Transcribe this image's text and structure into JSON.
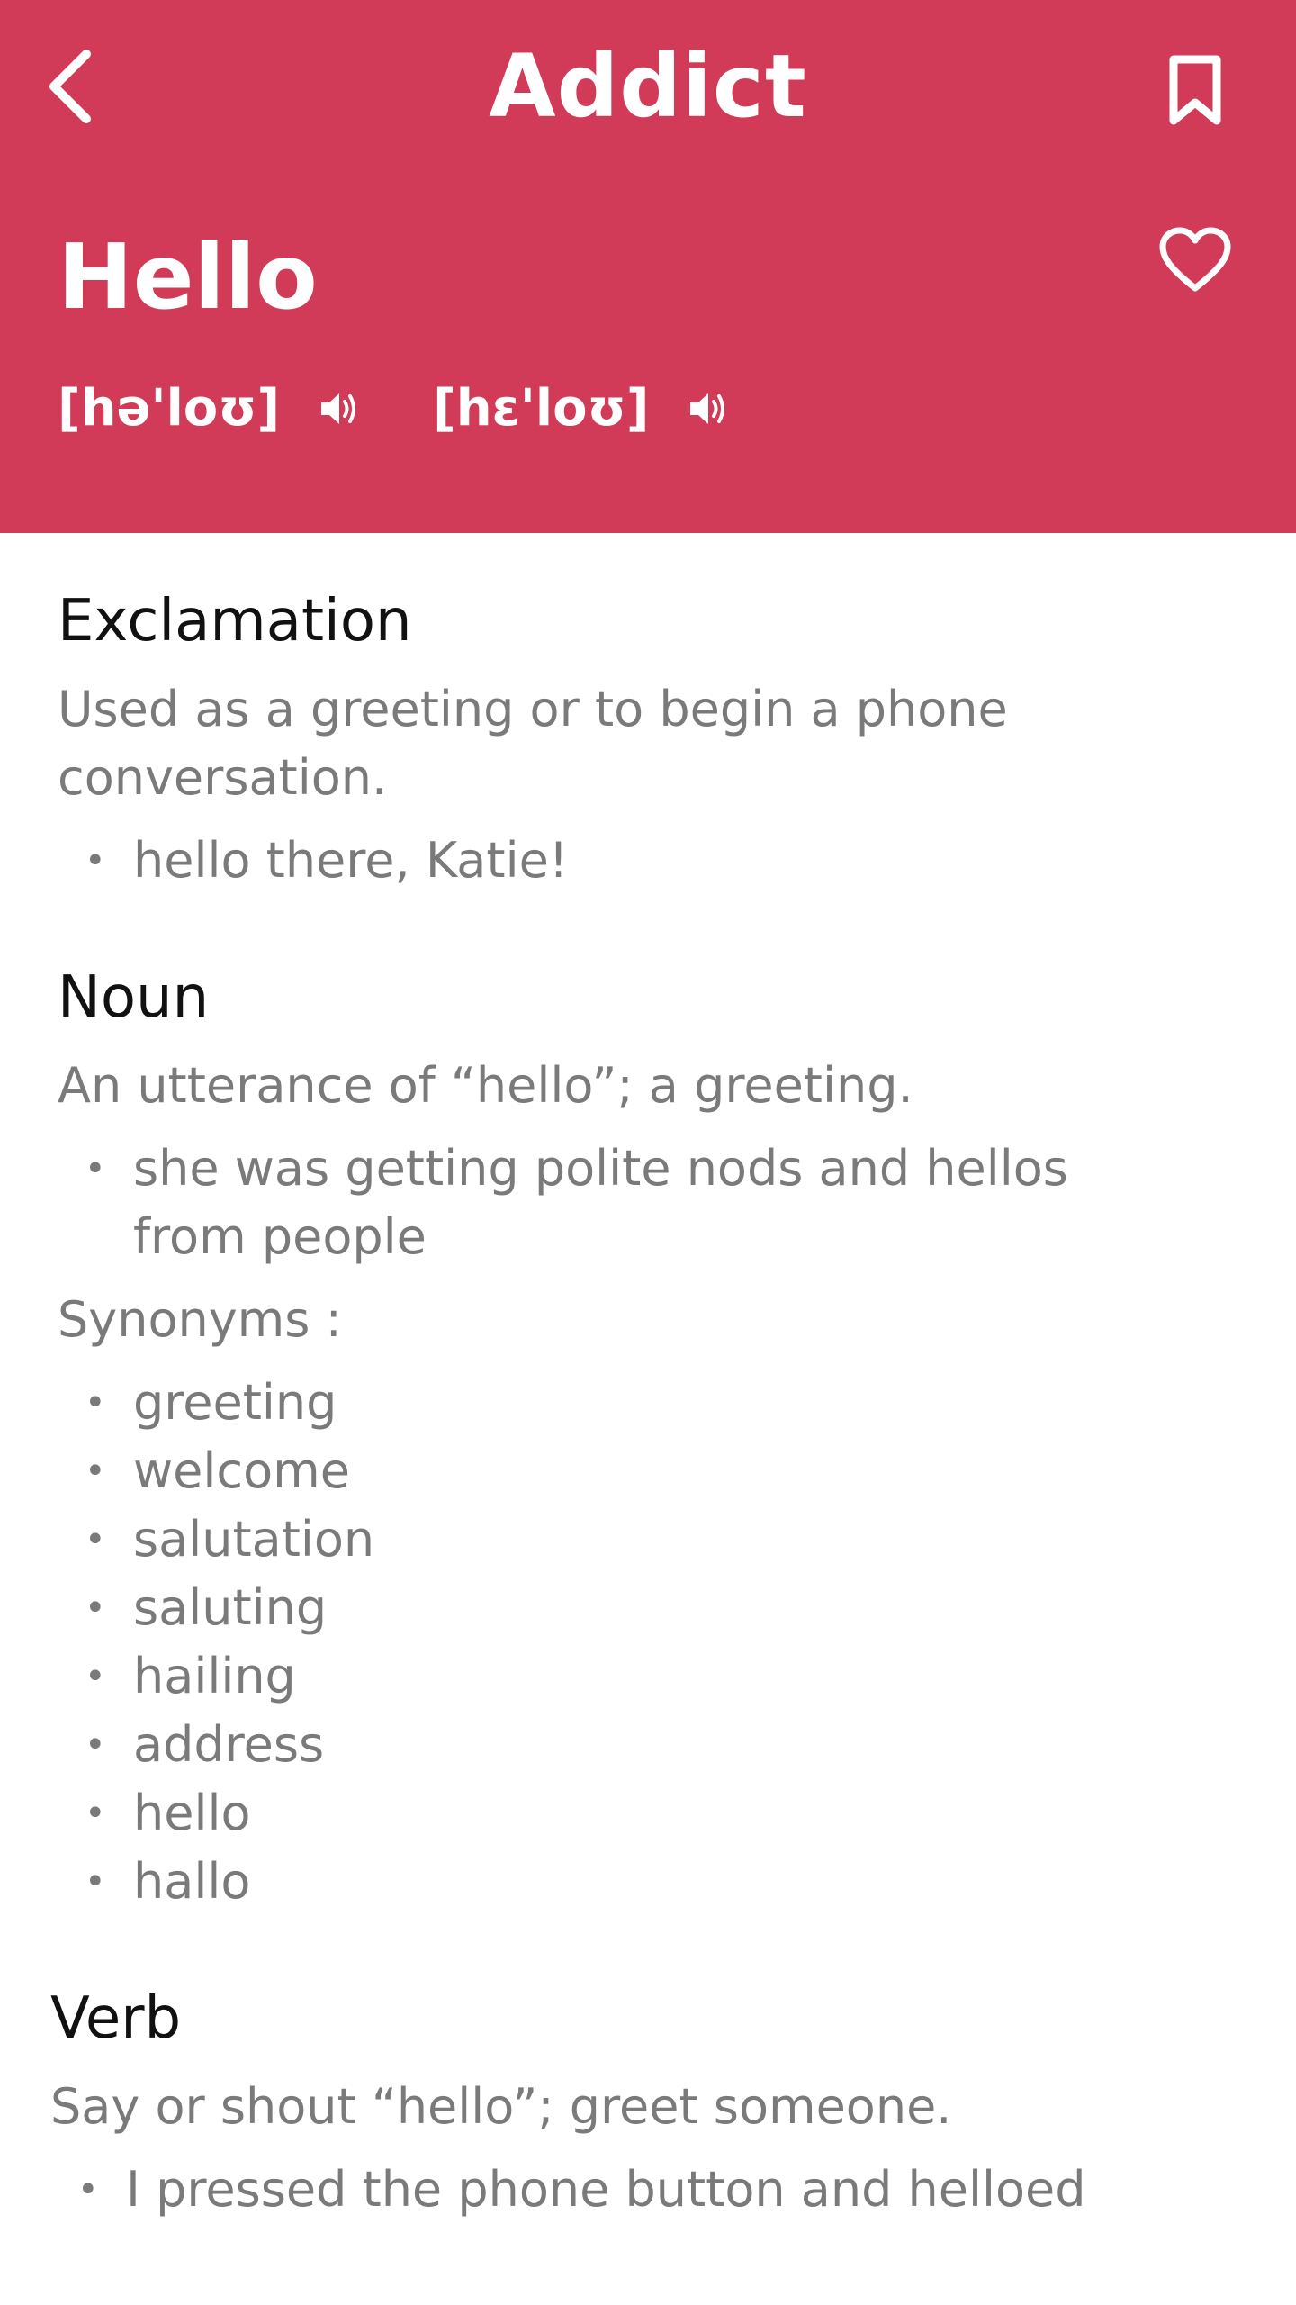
{
  "header": {
    "app_title": "Addict",
    "word": "Hello",
    "pronunciations": [
      {
        "text": "[hə'loʊ]"
      },
      {
        "text": "[hɛ'loʊ]"
      }
    ],
    "icons": {
      "back": "chevron-left-icon",
      "bookmark": "bookmark-icon",
      "favorite": "heart-outline-icon",
      "speaker": "speaker-icon"
    },
    "background_color": "#d23b57"
  },
  "sections": [
    {
      "part_of_speech": "Exclamation",
      "definition": "Used as a greeting or to begin a phone conversation.",
      "examples": [
        "hello there, Katie!"
      ]
    },
    {
      "part_of_speech": "Noun",
      "definition": "An utterance of “hello”; a greeting.",
      "examples": [
        "she was getting polite nods and hellos from people"
      ],
      "synonyms_label": "Synonyms :",
      "synonyms": [
        "greeting",
        "welcome",
        "salutation",
        "saluting",
        "hailing",
        "address",
        "hello",
        "hallo"
      ]
    },
    {
      "part_of_speech": "Verb",
      "definition": "Say or shout “hello”; greet someone.",
      "examples": [
        "I pressed the phone button and helloed"
      ]
    }
  ],
  "bullet_char": "•"
}
